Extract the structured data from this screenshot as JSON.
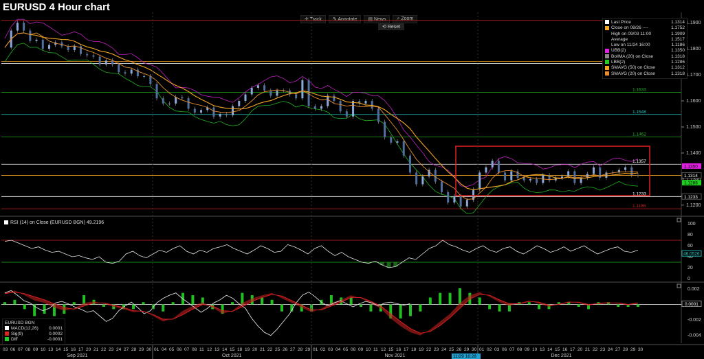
{
  "header": {
    "title": "EURUSD 4 Hour chart"
  },
  "toolbar": {
    "track": "Track",
    "annotate": "Annotate",
    "news": "News",
    "zoom": "Zoom",
    "reset": "Reset"
  },
  "legend": [
    {
      "label": "Last Price",
      "value": "1.1314",
      "color": "#ffffff"
    },
    {
      "label": "Close on 08/26 ----",
      "value": "1.1752",
      "color": "#f5a623"
    },
    {
      "label": "High on 09/03 11:00",
      "value": "1.1909",
      "color": ""
    },
    {
      "label": "Average",
      "value": "1.1517",
      "color": ""
    },
    {
      "label": "Low on 11/24 16:00",
      "value": "1.1186",
      "color": ""
    },
    {
      "label": "UBB(2)",
      "value": "1.1350",
      "color": "#e020e0"
    },
    {
      "label": "BollMA (20) on Close",
      "value": "1.1318",
      "color": "#8a8a8a"
    },
    {
      "label": "LBB(2)",
      "value": "1.1286",
      "color": "#20d020"
    },
    {
      "label": "SMAVG (50) on Close",
      "value": "1.1312",
      "color": "#f5a623"
    },
    {
      "label": "SMAVG (20) on Close",
      "value": "1.1318",
      "color": "#e89030"
    }
  ],
  "rsi": {
    "label": "RSI (14) on Close (EURUSD BGN) 49.2196",
    "value_badge": "46.0526",
    "ticks": [
      "100",
      "80",
      "60",
      "40",
      "20",
      "0"
    ]
  },
  "macd": {
    "legend_title": "EURUSD BGN",
    "rows": [
      {
        "label": "MACD(12,26)",
        "value": "0.0001",
        "color": "#ffffff"
      },
      {
        "label": "Sig(9)",
        "value": "0.0002",
        "color": "#e02020"
      },
      {
        "label": "Diff",
        "value": "-0.0001",
        "color": "#20d020"
      }
    ],
    "ticks": [
      "0.002",
      "0",
      "-0.002",
      "-0.004"
    ],
    "value_badge": "0.0001"
  },
  "axis": {
    "days": [
      "03",
      "06",
      "07",
      "08",
      "09",
      "10",
      "13",
      "14",
      "15",
      "16",
      "17",
      "20",
      "21",
      "22",
      "23",
      "24",
      "27",
      "28",
      "29",
      "30",
      "01",
      "04",
      "05",
      "06",
      "07",
      "08",
      "11",
      "12",
      "13",
      "14",
      "15",
      "18",
      "19",
      "20",
      "21",
      "22",
      "25",
      "26",
      "27",
      "28",
      "29",
      "01",
      "02",
      "03",
      "04",
      "05",
      "08",
      "09",
      "10",
      "11",
      "12",
      "15",
      "16",
      "17",
      "18",
      "19",
      "22",
      "23",
      "24",
      "25",
      "26",
      "29",
      "30",
      "01",
      "02",
      "03",
      "06",
      "07",
      "08",
      "09",
      "10",
      "13",
      "14",
      "15",
      "16",
      "17",
      "20",
      "21",
      "22",
      "23",
      "24",
      "27",
      "28",
      "29",
      "30"
    ],
    "months": [
      "Sep 2021",
      "Oct 2021",
      "Nov 2021",
      "Dec 2021"
    ],
    "cursor_date": "11/29 16:28",
    "price_ticks": [
      "1.1900",
      "1.1800",
      "1.1700",
      "1.1600",
      "1.1500",
      "1.1400",
      "1.1300",
      "1.1200"
    ]
  },
  "chart_data": {
    "type": "line",
    "title": "EURUSD 4 Hour chart",
    "ylim": [
      1.116,
      1.194
    ],
    "price_path": [
      1.1805,
      1.187,
      1.19,
      1.187,
      1.183,
      1.1835,
      1.18,
      1.1815,
      1.1825,
      1.181,
      1.1795,
      1.181,
      1.178,
      1.1775,
      1.177,
      1.174,
      1.1755,
      1.174,
      1.171,
      1.1705,
      1.172,
      1.1695,
      1.1695,
      1.1665,
      1.161,
      1.159,
      1.159,
      1.1615,
      1.161,
      1.157,
      1.1555,
      1.1565,
      1.1575,
      1.154,
      1.155,
      1.1545,
      1.158,
      1.16,
      1.1625,
      1.165,
      1.166,
      1.164,
      1.162,
      1.164,
      1.164,
      1.1625,
      1.161,
      1.168,
      1.158,
      1.157,
      1.158,
      1.162,
      1.16,
      1.156,
      1.154,
      1.16,
      1.159,
      1.16,
      1.157,
      1.152,
      1.146,
      1.144,
      1.1445,
      1.139,
      1.1325,
      1.128,
      1.131,
      1.1335,
      1.129,
      1.125,
      1.121,
      1.1235,
      1.1195,
      1.122,
      1.126,
      1.1325,
      1.1345,
      1.137,
      1.1325,
      1.1295,
      1.133,
      1.1305,
      1.1295,
      1.13,
      1.1285,
      1.1315,
      1.1295,
      1.1305,
      1.131,
      1.133,
      1.1285,
      1.1305,
      1.132,
      1.1345,
      1.1305,
      1.1325,
      1.1325,
      1.1335,
      1.1345,
      1.1315,
      1.1314
    ],
    "levels": [
      {
        "value": 1.1909,
        "color": "#d02020",
        "label": ""
      },
      {
        "value": 1.1752,
        "color": "#f5a623",
        "label": ""
      },
      {
        "value": 1.1744,
        "color": "#ffffff",
        "label": ""
      },
      {
        "value": 1.1633,
        "color": "#20b020",
        "label": "1.1633"
      },
      {
        "value": 1.1548,
        "color": "#20c0c0",
        "label": "1.1548"
      },
      {
        "value": 1.1462,
        "color": "#20b020",
        "label": "1.1462"
      },
      {
        "value": 1.1357,
        "color": "#ffffff",
        "label": "1.1357"
      },
      {
        "value": 1.1314,
        "color": "#f5a623",
        "label": ""
      },
      {
        "value": 1.1233,
        "color": "#ffffff",
        "label": "1.1233"
      },
      {
        "value": 1.1186,
        "color": "#d02020",
        "label": "1.1186"
      }
    ],
    "badges": [
      {
        "value": 1.135,
        "text": "1.1350",
        "bg": "#e020e0",
        "fg": "#000"
      },
      {
        "value": 1.1314,
        "text": "1.1314",
        "bg": "#000",
        "fg": "#fff"
      },
      {
        "value": 1.1286,
        "text": "1.1286",
        "bg": "#20d020",
        "fg": "#000"
      },
      {
        "value": 1.1233,
        "text": "1.1233",
        "bg": "#000",
        "fg": "#fff"
      }
    ],
    "rsi_path": [
      68,
      70,
      65,
      60,
      55,
      58,
      52,
      48,
      50,
      45,
      40,
      42,
      38,
      35,
      40,
      30,
      28,
      32,
      45,
      50,
      42,
      38,
      45,
      52,
      48,
      55,
      60,
      50,
      45,
      52,
      48,
      55,
      58,
      62,
      55,
      50,
      45,
      52,
      60,
      55,
      48,
      50,
      62,
      58,
      52,
      45,
      55,
      60,
      50,
      42,
      48,
      40,
      35,
      30,
      28,
      32,
      25,
      20,
      22,
      30,
      38,
      35,
      45,
      55,
      60,
      70,
      62,
      58,
      52,
      48,
      55,
      60,
      52,
      48,
      55,
      58,
      50,
      45,
      52,
      60,
      55,
      48,
      52,
      58,
      50,
      55,
      60,
      52,
      45,
      50,
      55,
      58,
      50,
      48,
      52
    ],
    "macd_path": [
      0.0015,
      0.0018,
      0.0012,
      0.0005,
      0.0002,
      -0.0004,
      -0.0008,
      -0.0005,
      0.0002,
      0.0004,
      0.0001,
      -0.0003,
      -0.0006,
      -0.001,
      -0.0008,
      -0.0015,
      -0.0022,
      -0.0018,
      -0.0008,
      -0.0002,
      0.0003,
      -0.0004,
      -0.0012,
      -0.0008,
      0.0002,
      0.0008,
      0.0012,
      0.0015,
      0.0008,
      0.0002,
      -0.0004,
      -0.001,
      -0.0005,
      0.0002,
      0.0006,
      0.0012,
      0.0008,
      0.0001,
      -0.0005,
      -0.0018,
      -0.0028,
      -0.0036,
      -0.004,
      -0.0032,
      -0.0022,
      -0.0012,
      0.0002,
      0.0012,
      0.0016,
      0.001,
      0.0003,
      -0.0002,
      0.0002,
      0.0005,
      0.0001,
      -0.0003,
      0.0001,
      0.0004,
      0.0002,
      -0.0002,
      0.0002,
      0.0003,
      0.0001,
      -0.0001,
      0.0001
    ],
    "signal_path": [
      0.0014,
      0.0016,
      0.0014,
      0.001,
      0.0006,
      0.0001,
      -0.0004,
      -0.0006,
      -0.0002,
      0.0002,
      0.0002,
      -0.0001,
      -0.0004,
      -0.0008,
      -0.0009,
      -0.0013,
      -0.0019,
      -0.0019,
      -0.0013,
      -0.0006,
      0.0,
      -0.0002,
      -0.0008,
      -0.0009,
      -0.0003,
      0.0004,
      0.0009,
      0.0013,
      0.0011,
      0.0005,
      -0.0001,
      -0.0007,
      -0.0007,
      -0.0002,
      0.0003,
      0.0009,
      0.0009,
      0.0004,
      -0.0002,
      -0.0012,
      -0.0022,
      -0.0031,
      -0.0037,
      -0.0035,
      -0.0027,
      -0.0017,
      -0.0005,
      0.0007,
      0.0013,
      0.0012,
      0.0006,
      0.0001,
      0.0001,
      0.0004,
      0.0003,
      -0.0001,
      0.0,
      0.0003,
      0.0003,
      0.0,
      0.0001,
      0.0002,
      0.0002,
      0.0,
      0.0002
    ]
  }
}
